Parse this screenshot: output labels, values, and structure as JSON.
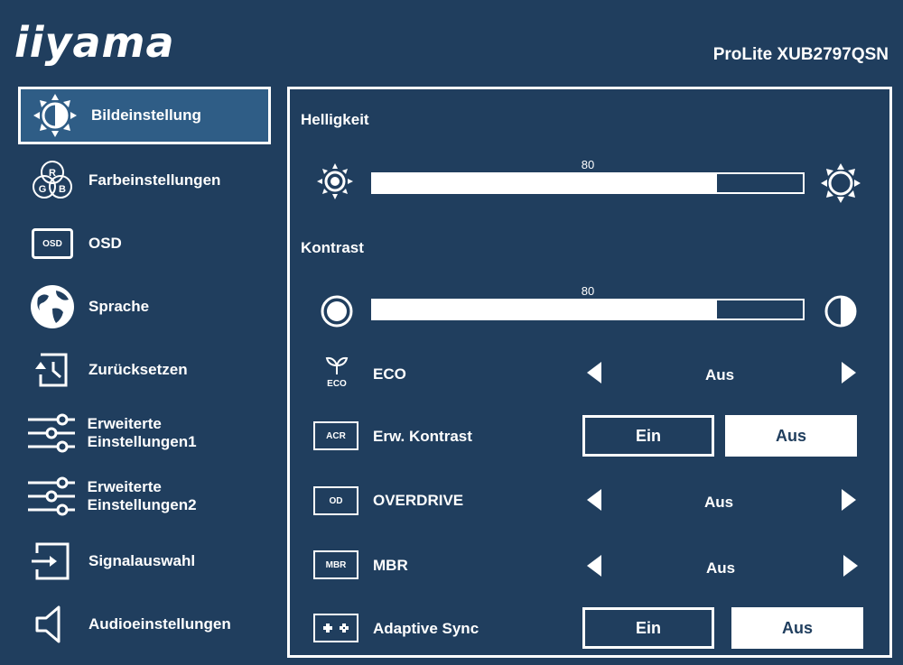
{
  "brand": "iiyama",
  "model": "ProLite XUB2797QSN",
  "sidebar": {
    "items": [
      {
        "label": "Bildeinstellung"
      },
      {
        "label": "Farbeinstellungen"
      },
      {
        "label": "OSD",
        "icon_text": "OSD"
      },
      {
        "label": "Sprache"
      },
      {
        "label": "Zurücksetzen"
      },
      {
        "label": "Erweiterte Einstellungen1"
      },
      {
        "label": "Erweiterte Einstellungen2"
      },
      {
        "label": "Signalauswahl"
      },
      {
        "label": "Audioeinstellungen"
      }
    ],
    "farb_icon_letters": {
      "r": "R",
      "g": "G",
      "b": "B"
    },
    "active_index": 0
  },
  "panel": {
    "brightness": {
      "label": "Helligkeit",
      "value": 80,
      "value_text": "80",
      "max": 100
    },
    "contrast": {
      "label": "Kontrast",
      "value": 80,
      "value_text": "80",
      "max": 100
    },
    "eco": {
      "label": "ECO",
      "icon_text": "ECO",
      "value": "Aus"
    },
    "erw_kontrast": {
      "label": "Erw. Kontrast",
      "icon_text": "ACR",
      "on": "Ein",
      "off": "Aus",
      "selected": "Aus"
    },
    "overdrive": {
      "label": "OVERDRIVE",
      "icon_text": "OD",
      "value": "Aus"
    },
    "mbr": {
      "label": "MBR",
      "icon_text": "MBR",
      "value": "Aus"
    },
    "adaptive_sync": {
      "label": "Adaptive Sync",
      "on": "Ein",
      "off": "Aus",
      "selected": "Aus"
    }
  },
  "colors": {
    "background": "#203e5e",
    "highlight": "#2f5d86",
    "foreground": "#ffffff"
  }
}
